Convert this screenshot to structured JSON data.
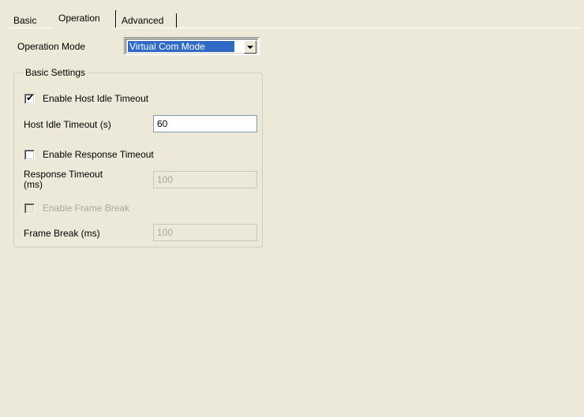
{
  "tabs": [
    {
      "label": "Basic",
      "selected": false
    },
    {
      "label": "Operation",
      "selected": true
    },
    {
      "label": "Advanced",
      "selected": false
    }
  ],
  "operation_mode": {
    "label": "Operation Mode",
    "selected_value": "Virtual Com Mode"
  },
  "basic_settings": {
    "legend": "Basic Settings",
    "enable_host_idle_timeout": {
      "label": "Enable Host Idle Timeout",
      "checked": true,
      "enabled": true
    },
    "host_idle_timeout": {
      "label": "Host Idle Timeout (s)",
      "value": "60",
      "enabled": true
    },
    "enable_response_timeout": {
      "label": "Enable Response Timeout",
      "checked": false,
      "enabled": true
    },
    "response_timeout": {
      "label_line1": "Response Timeout",
      "label_line2": "(ms)",
      "value": "100",
      "enabled": false
    },
    "enable_frame_break": {
      "label": "Enable Frame Break",
      "checked": false,
      "enabled": false
    },
    "frame_break": {
      "label": "Frame Break (ms)",
      "value": "100",
      "enabled": false
    }
  },
  "colors": {
    "background": "#ece9d8",
    "selection": "#316ac5",
    "disabled_text": "#aca899"
  }
}
